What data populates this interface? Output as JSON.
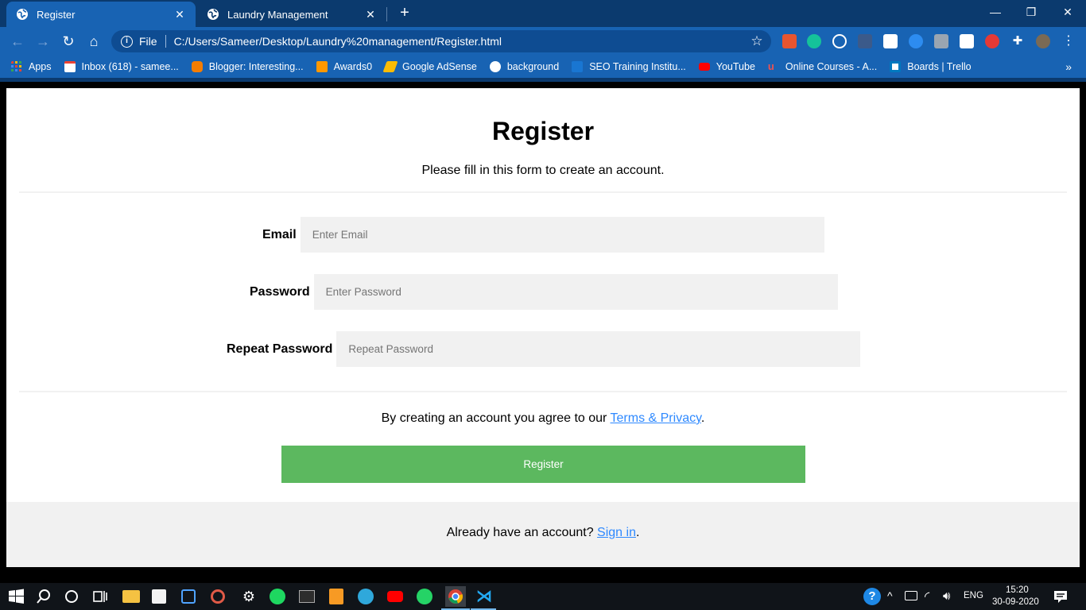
{
  "browser": {
    "tabs": [
      {
        "title": "Register",
        "active": true
      },
      {
        "title": "Laundry Management",
        "active": false
      }
    ],
    "address": {
      "scheme_label": "File",
      "url": "C:/Users/Sameer/Desktop/Laundry%20management/Register.html"
    },
    "bookmarks": [
      {
        "label": "Apps",
        "icon": "apps-grid-icon",
        "color": "#e94235"
      },
      {
        "label": "Inbox (618) - samee...",
        "icon": "gmail-icon",
        "color": "#ea4335"
      },
      {
        "label": "Blogger: Interesting...",
        "icon": "blogger-icon",
        "color": "#f57d00"
      },
      {
        "label": "Awards0",
        "icon": "awards-icon",
        "color": "#ff9800"
      },
      {
        "label": "Google AdSense",
        "icon": "adsense-icon",
        "color": "#fbbc04"
      },
      {
        "label": "background",
        "icon": "globe-icon",
        "color": "#ffffff"
      },
      {
        "label": "SEO Training Institu...",
        "icon": "seo-icon",
        "color": "#1976d2"
      },
      {
        "label": "YouTube",
        "icon": "youtube-icon",
        "color": "#ff0000"
      },
      {
        "label": "Online Courses - A...",
        "icon": "udemy-icon",
        "color": "#ec5252"
      },
      {
        "label": "Boards | Trello",
        "icon": "trello-icon",
        "color": "#0079bf"
      }
    ]
  },
  "page": {
    "title": "Register",
    "subtitle": "Please fill in this form to create an account.",
    "fields": [
      {
        "label": "Email",
        "placeholder": "Enter Email"
      },
      {
        "label": "Password",
        "placeholder": "Enter Password"
      },
      {
        "label": "Repeat Password",
        "placeholder": "Repeat Password"
      }
    ],
    "agree_text": "By creating an account you agree to our ",
    "terms_link": "Terms & Privacy",
    "period": ".",
    "register_button": "Register",
    "signin_text": "Already have an account? ",
    "signin_link": "Sign in"
  },
  "taskbar": {
    "language": "ENG",
    "time": "15:20",
    "date": "30-09-2020"
  },
  "colors": {
    "register_button": "#5cb85f",
    "link": "#2e89ff",
    "input_bg": "#f1f1f1",
    "browser_frame": "#1863b3"
  }
}
